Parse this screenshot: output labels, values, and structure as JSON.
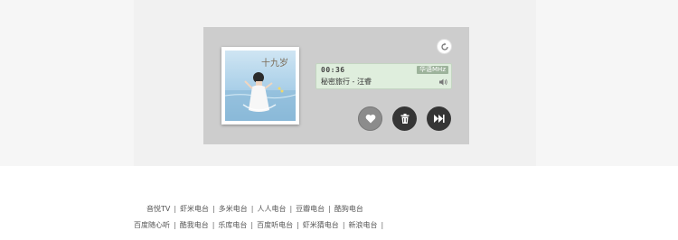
{
  "player": {
    "time": "00:36",
    "quality_badge": "华语MHz",
    "song": "秘密旅行 - 汪睿",
    "cover_title": "十九岁",
    "colors": {
      "screen_bg": "#dfeedd",
      "panel_bg": "#cdcdcd",
      "button_dark": "#353535",
      "button_like": "#8c8c8c"
    },
    "icons": [
      "refresh-icon",
      "volume-icon",
      "heart-icon",
      "trash-icon",
      "next-icon"
    ]
  },
  "footer": {
    "row1": [
      "音悦TV",
      "虾米电台",
      "多米电台",
      "人人电台",
      "豆瓣电台",
      "酷狗电台"
    ],
    "row2": [
      "百度随心听",
      "酷我电台",
      "乐库电台",
      "百度听电台",
      "虾米猜电台",
      "新浪电台"
    ]
  }
}
